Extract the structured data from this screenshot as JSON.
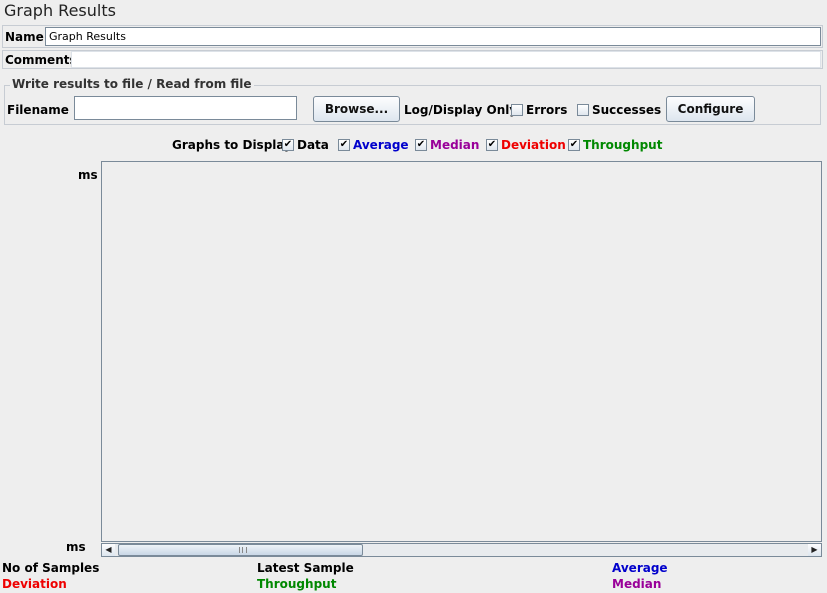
{
  "window": {
    "title": "Graph Results"
  },
  "name_row": {
    "label": "Name:",
    "value": "Graph Results"
  },
  "comments_row": {
    "label": "Comments:",
    "value": ""
  },
  "file_panel": {
    "legend": "Write results to file / Read from file",
    "filename_label": "Filename",
    "filename_value": "",
    "browse_label": "Browse...",
    "log_display_label": "Log/Display Only:",
    "errors_label": "Errors",
    "errors_checked": false,
    "successes_label": "Successes",
    "successes_checked": false,
    "configure_label": "Configure"
  },
  "graphs_to_display": {
    "label": "Graphs to Display",
    "options": [
      {
        "label": "Data",
        "checked": true,
        "color": "#000000"
      },
      {
        "label": "Average",
        "checked": true,
        "color": "#0000cc"
      },
      {
        "label": "Median",
        "checked": true,
        "color": "#990099"
      },
      {
        "label": "Deviation",
        "checked": true,
        "color": "#ee0000"
      },
      {
        "label": "Throughput",
        "checked": true,
        "color": "#008800"
      }
    ]
  },
  "graph": {
    "y_top_label": "ms",
    "y_bottom_label": "ms"
  },
  "stats": {
    "no_of_samples": "No of Samples",
    "deviation": "Deviation",
    "latest_sample": "Latest Sample",
    "throughput": "Throughput",
    "average": "Average",
    "median": "Median"
  },
  "colors": {
    "data": "#000000",
    "average": "#0000cc",
    "median": "#990099",
    "deviation": "#ee0000",
    "throughput": "#008800"
  },
  "icons": {
    "checkbox_mark": "✔",
    "scroll_left": "◀",
    "scroll_right": "▶"
  }
}
